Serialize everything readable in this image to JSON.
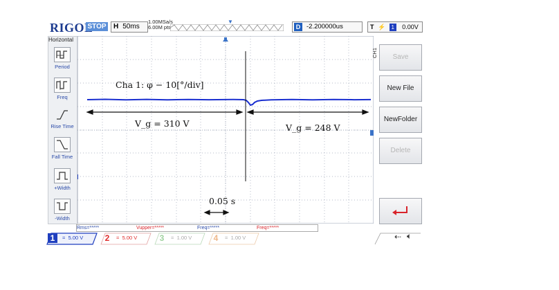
{
  "header": {
    "brand": "RIGOL",
    "run_status": "STOP",
    "hbase_label": "H",
    "hbase_value": "50ms",
    "sample_rate": "1.00MSa/s",
    "mem_depth": "6.00M pts",
    "delay_label": "D",
    "delay_value": "-2.200000us",
    "trigger_label": "T",
    "trigger_source": "1",
    "trigger_level": "0.00V"
  },
  "left_panel": {
    "title": "Horizontal",
    "items": [
      {
        "label": "Period"
      },
      {
        "label": "Freq"
      },
      {
        "label": "Rise Time"
      },
      {
        "label": "Fall Time"
      },
      {
        "label": "+Width"
      },
      {
        "label": "-Width"
      }
    ]
  },
  "softkeys": {
    "ch_tab": "CH1",
    "save": "Save",
    "new_file": "New File",
    "new_folder": "NewFolder",
    "delete": "Delete",
    "return_icon": "return-arrow"
  },
  "meas_row": {
    "rms": "Rms=*****",
    "vupper": "Vupper=*****",
    "freq1": "Freq=*****",
    "freq2": "Freq=*****"
  },
  "channels": [
    {
      "num": "1",
      "scale": "5.00 V",
      "color": "#1f3fbf"
    },
    {
      "num": "2",
      "scale": "5.00 V",
      "color": "#e02b2b"
    },
    {
      "num": "3",
      "scale": "1.00 V",
      "color": "#3aa33a"
    },
    {
      "num": "4",
      "scale": "1.00 V",
      "color": "#d97a2b"
    }
  ],
  "annotations": {
    "channel_note": "Cha 1: φ − 10[°/div]",
    "vg_left": "V_g = 310 V",
    "vg_right": "V_g = 248 V",
    "time_span": "0.05 s"
  },
  "colors": {
    "trace": "#1a2fd0",
    "grid": "#9aa3b5",
    "brand": "#1b3a8f",
    "accent": "#3a73c8"
  }
}
